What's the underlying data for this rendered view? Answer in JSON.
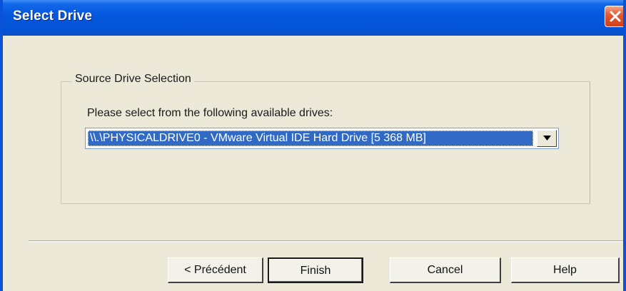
{
  "window": {
    "title": "Select Drive"
  },
  "group": {
    "legend": "Source Drive Selection",
    "prompt": "Please select from the following available drives:"
  },
  "drive_select": {
    "selected_value": "\\\\.\\PHYSICALDRIVE0 - VMware Virtual IDE Hard Drive [5 368 MB]"
  },
  "buttons": {
    "previous": "< Précédent",
    "finish": "Finish",
    "cancel": "Cancel",
    "help": "Help"
  },
  "icons": {
    "close": "close-icon",
    "dropdown": "chevron-down-icon"
  },
  "colors": {
    "titlebar": "#0453d6",
    "selection": "#316ac5",
    "dialog_bg": "#ece9d8",
    "close_button": "#e35a34"
  }
}
